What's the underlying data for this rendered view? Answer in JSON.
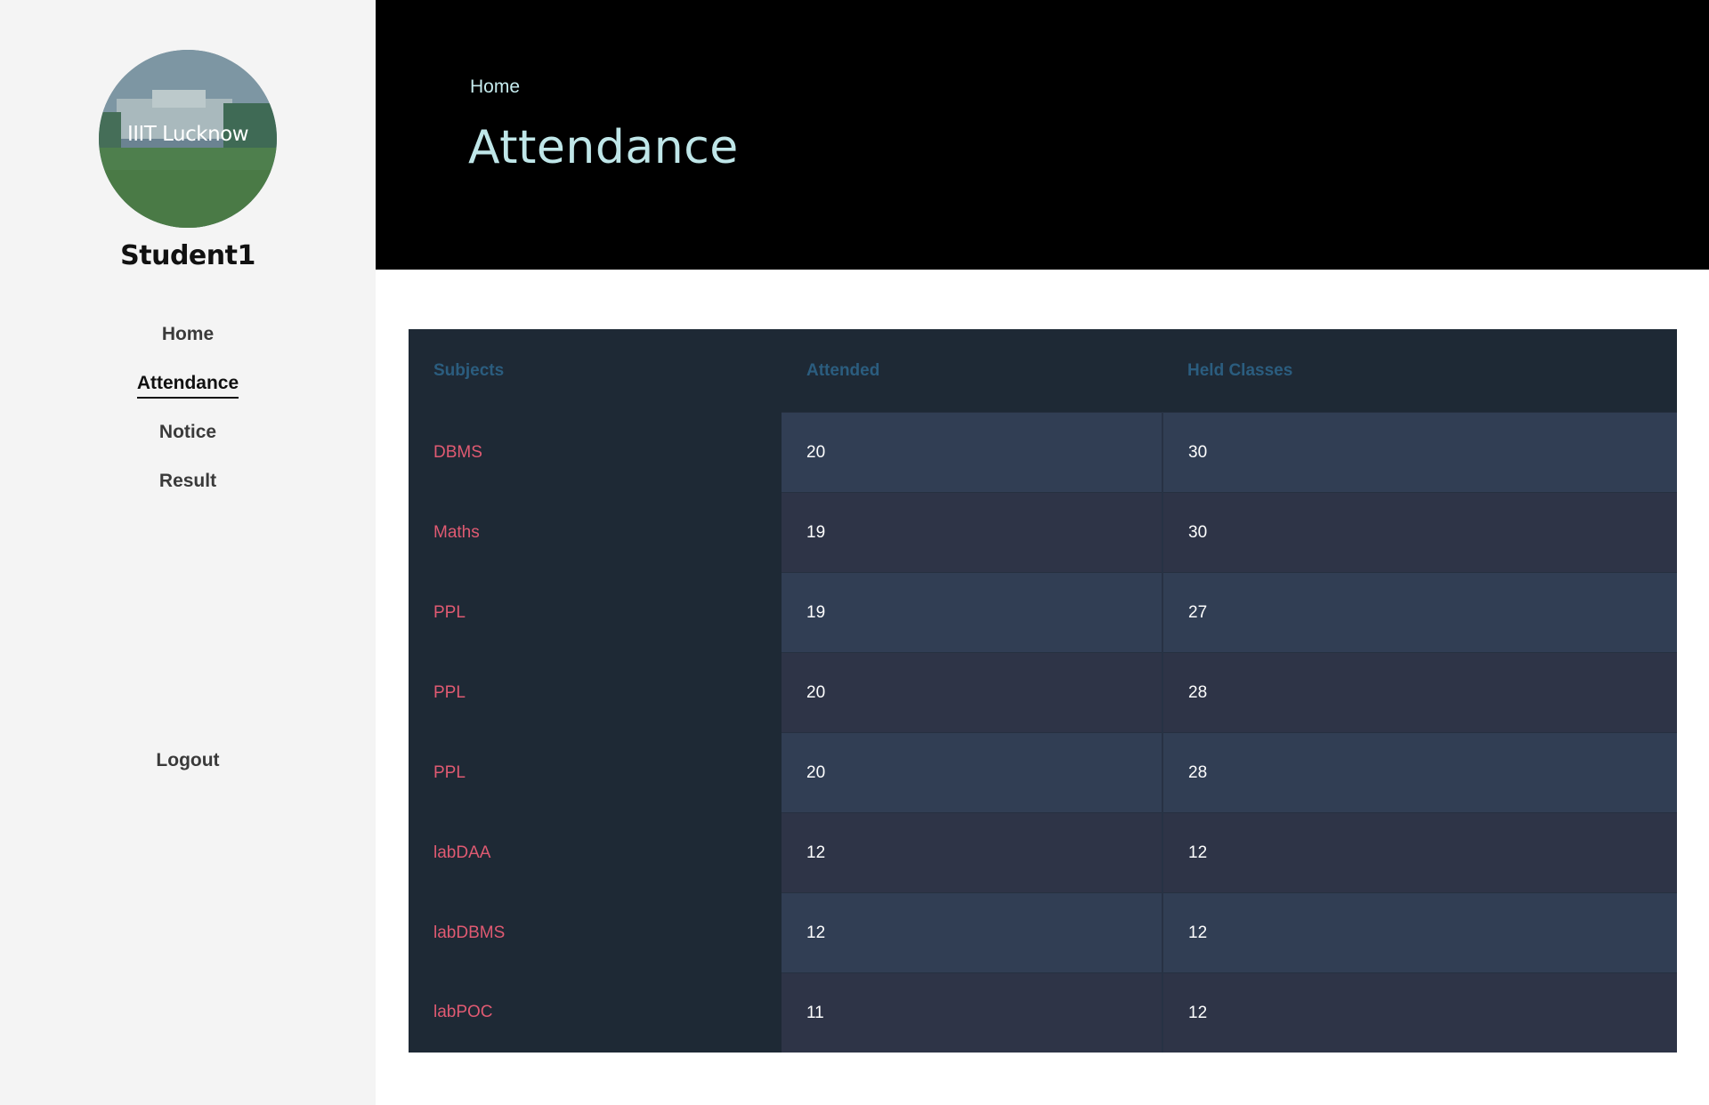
{
  "sidebar": {
    "avatar_text": "IIIT Lucknow",
    "username": "Student1",
    "nav": [
      {
        "label": "Home",
        "active": false
      },
      {
        "label": "Attendance",
        "active": true
      },
      {
        "label": "Notice",
        "active": false
      },
      {
        "label": "Result",
        "active": false
      }
    ],
    "logout_label": "Logout"
  },
  "header": {
    "breadcrumb": "Home",
    "title": "Attendance"
  },
  "table": {
    "columns": [
      "Subjects",
      "Attended",
      "Held Classes"
    ],
    "rows": [
      {
        "subject": "DBMS",
        "attended": "20",
        "held": "30"
      },
      {
        "subject": "Maths",
        "attended": "19",
        "held": "30"
      },
      {
        "subject": "PPL",
        "attended": "19",
        "held": "27"
      },
      {
        "subject": "PPL",
        "attended": "20",
        "held": "28"
      },
      {
        "subject": "PPL",
        "attended": "20",
        "held": "28"
      },
      {
        "subject": "labDAA",
        "attended": "12",
        "held": "12"
      },
      {
        "subject": "labDBMS",
        "attended": "12",
        "held": "12"
      },
      {
        "subject": "labPOC",
        "attended": "11",
        "held": "12"
      }
    ]
  },
  "colors": {
    "sidebar_bg": "#f4f4f4",
    "header_bg": "#000000",
    "title_color": "#bfe6e8",
    "table_bg": "#1e2935",
    "header_text": "#2b5d7f",
    "subject_text": "#e05a72",
    "row_odd": "#313e54",
    "row_even": "#2e3447"
  }
}
